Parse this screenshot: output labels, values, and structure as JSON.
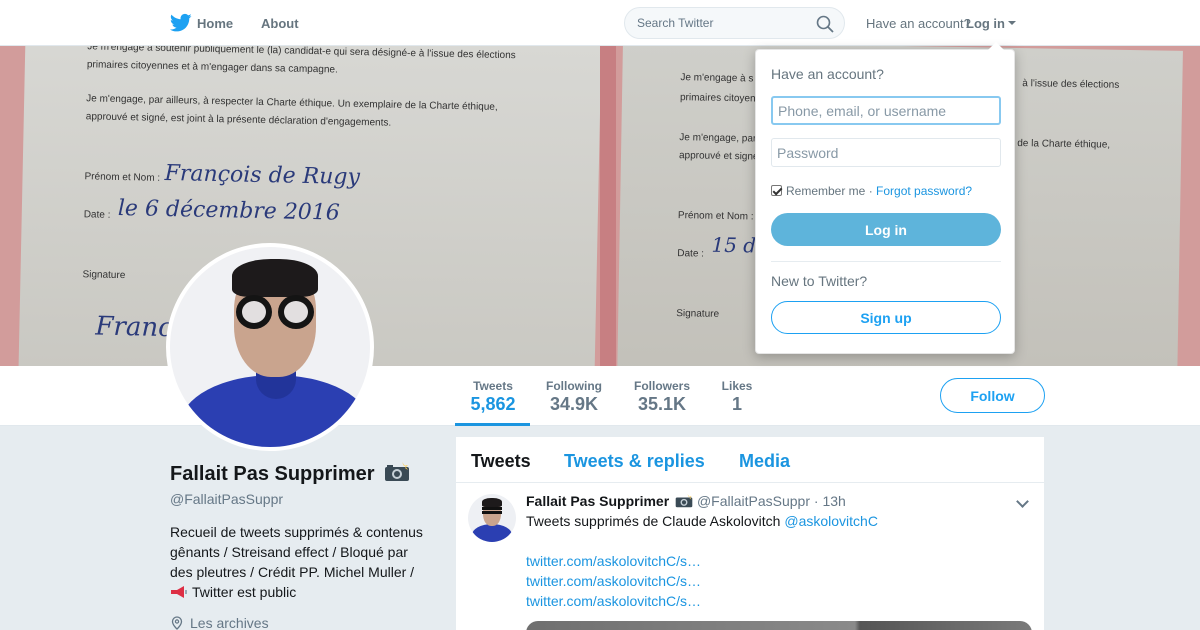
{
  "nav": {
    "home_label": "Home",
    "about_label": "About",
    "search_placeholder": "Search Twitter",
    "have_account": "Have an account?",
    "login_label": "Log in"
  },
  "banner": {
    "left_lines": [
      "Je m'engage à soutenir publiquement le (la) candidat-e qui sera désigné-e à l'issue des élections",
      "primaires citoyennes et à m'engager dans sa campagne.",
      "Je m'engage, par ailleurs, à respecter la Charte éthique. Un exemplaire de la Charte éthique,",
      "approuvé et signé, est joint à la présente déclaration d'engagements."
    ],
    "name_label": "Prénom et Nom :",
    "name_value": "François de Rugy",
    "date_label": "Date :",
    "date_value": "le 6 décembre 2016",
    "signature_label": "Signature",
    "signature_value": "Franc",
    "right_lines": [
      "Je m'engage à s",
      "primaires citoyen",
      "Je m'engage, par",
      "approuvé et signé",
      "à l'issue des élections",
      "de la Charte éthique,"
    ],
    "right_name_label": "Prénom et Nom :",
    "right_date_label": "Date :",
    "right_date_value": "15 dé",
    "right_signature_label": "Signature"
  },
  "stats": [
    {
      "label": "Tweets",
      "value": "5,862"
    },
    {
      "label": "Following",
      "value": "34.9K"
    },
    {
      "label": "Followers",
      "value": "35.1K"
    },
    {
      "label": "Likes",
      "value": "1"
    }
  ],
  "follow_label": "Follow",
  "profile": {
    "name": "Fallait Pas Supprimer",
    "handle": "@FallaitPasSuppr",
    "bio": "Recueil de tweets supprimés & contenus gênants / Streisand effect / Bloqué par des pleutres / Crédit PP. Michel Muller /",
    "bio_tail": "Twitter est public",
    "location": "Les archives"
  },
  "timeline": {
    "tabs": [
      "Tweets",
      "Tweets & replies",
      "Media"
    ],
    "tweet": {
      "name": "Fallait Pas Supprimer",
      "handle": "@FallaitPasSuppr",
      "time": "· 13h",
      "text": "Tweets supprimés de Claude Askolovitch",
      "mention": "@askolovitchC",
      "links": [
        "twitter.com/askolovitchC/s…",
        "twitter.com/askolovitchC/s…",
        "twitter.com/askolovitchC/s…"
      ]
    }
  },
  "login_dropdown": {
    "title": "Have an account?",
    "username_placeholder": "Phone, email, or username",
    "password_placeholder": "Password",
    "remember": "Remember me ·",
    "forgot": "Forgot password?",
    "login_button": "Log in",
    "new_to": "New to Twitter?",
    "signup_button": "Sign up"
  },
  "colors": {
    "accent": "#1da1f2",
    "link": "#1b95e0",
    "login_button": "#5eb4db"
  }
}
